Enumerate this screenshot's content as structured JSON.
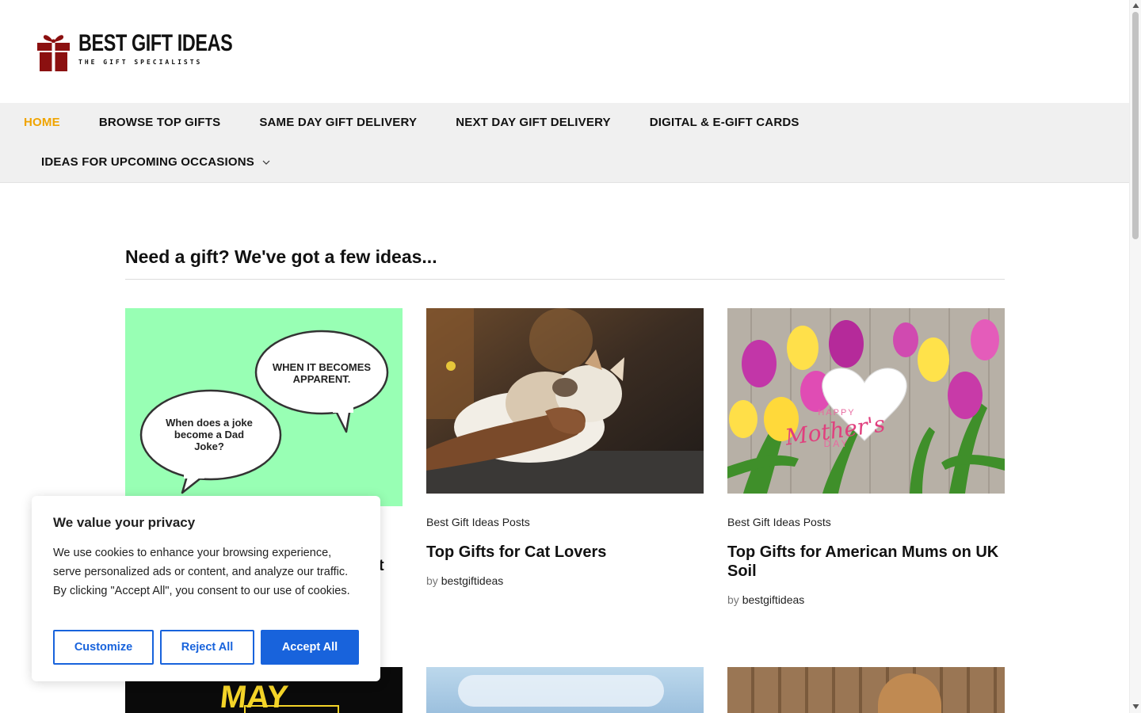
{
  "logo": {
    "title": "BEST GIFT IDEAS",
    "tagline": "THE GIFT SPECIALISTS",
    "icon": "gift-box-icon",
    "color": "#8b1010"
  },
  "nav": {
    "items": [
      {
        "label": "HOME",
        "active": true
      },
      {
        "label": "BROWSE TOP GIFTS"
      },
      {
        "label": "SAME DAY GIFT DELIVERY"
      },
      {
        "label": "NEXT DAY GIFT DELIVERY"
      },
      {
        "label": "DIGITAL & E-GIFT CARDS"
      },
      {
        "label": "IDEAS FOR UPCOMING OCCASIONS",
        "has_dropdown": true
      }
    ],
    "active_color": "#f0a400"
  },
  "section": {
    "title": "Need a gift? We've got a few ideas..."
  },
  "cards": [
    {
      "category": "",
      "title": "t",
      "author_prefix": "",
      "author": "",
      "image": {
        "bubble1": "WHEN IT BECOMES APPARENT.",
        "bubble2": "When does a joke become a Dad Joke?",
        "bg": "#98ffb4"
      }
    },
    {
      "category": "Best Gift Ideas Posts",
      "title": "Top Gifts for Cat Lovers",
      "author_prefix": "by",
      "author": "bestgiftideas"
    },
    {
      "category": "Best Gift Ideas Posts",
      "title": "Top Gifts for American Mums on UK Soil",
      "author_prefix": "by",
      "author": "bestgiftideas",
      "image": {
        "heart_line1": "HAPPY",
        "heart_line2": "Mother's",
        "heart_line3": "DAY"
      }
    }
  ],
  "bottom_cards": [
    {
      "image_text": "MAY"
    },
    {},
    {}
  ],
  "cookie": {
    "title": "We value your privacy",
    "text": "We use cookies to enhance your browsing experience, serve personalized ads or content, and analyze our traffic. By clicking \"Accept All\", you consent to our use of cookies.",
    "customize": "Customize",
    "reject": "Reject All",
    "accept": "Accept All",
    "accent": "#1863dc"
  }
}
